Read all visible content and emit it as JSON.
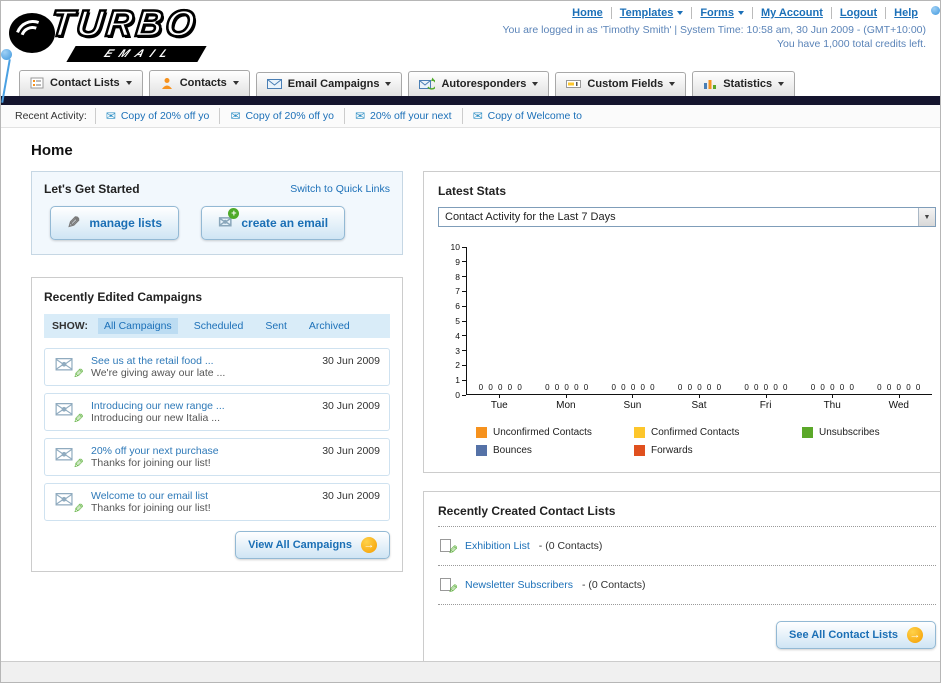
{
  "icons": {
    "envelope": "✉",
    "pencil": "✎",
    "plus": "+",
    "arrow_right": "→",
    "select_arrow": "▼"
  },
  "header": {
    "logo": {
      "title": "TURBO",
      "subtitle": "EMAIL"
    },
    "links": [
      "Home",
      "Templates",
      "Forms",
      "My Account",
      "Logout",
      "Help"
    ],
    "login_info": "You are logged in as 'Timothy Smith' | System Time: 10:58 am, 30 Jun 2009 - (GMT+10:00)",
    "credits_info": "You have 1,000 total credits left."
  },
  "nav_tabs": [
    {
      "label": "Contact Lists"
    },
    {
      "label": "Contacts"
    },
    {
      "label": "Email Campaigns"
    },
    {
      "label": "Autoresponders"
    },
    {
      "label": "Custom Fields"
    },
    {
      "label": "Statistics"
    }
  ],
  "recent_activity": {
    "label": "Recent Activity:",
    "items": [
      "Copy of 20% off yo",
      "Copy of 20% off yo",
      "20% off your next",
      "Copy of Welcome to"
    ]
  },
  "page_title": "Home",
  "get_started": {
    "title": "Let's Get Started",
    "switch_link": "Switch to Quick Links",
    "manage_lists_label": "manage lists",
    "create_email_label": "create an email"
  },
  "campaigns": {
    "title": "Recently Edited Campaigns",
    "show_label": "SHOW:",
    "tabs": [
      {
        "label": "All Campaigns",
        "selected": true
      },
      {
        "label": "Scheduled",
        "selected": false
      },
      {
        "label": "Sent",
        "selected": false
      },
      {
        "label": "Archived",
        "selected": false
      }
    ],
    "items": [
      {
        "title": "See us at the retail food ...",
        "subtitle": "We're giving away our late ...",
        "date": "30 Jun 2009"
      },
      {
        "title": "Introducing our new range ...",
        "subtitle": "Introducing our new Italia ...",
        "date": "30 Jun 2009"
      },
      {
        "title": "20% off your next purchase",
        "subtitle": "Thanks for joining our list!",
        "date": "30 Jun 2009"
      },
      {
        "title": "Welcome to our email list",
        "subtitle": "Thanks for joining our list!",
        "date": "30 Jun 2009"
      }
    ],
    "view_all_label": "View All Campaigns"
  },
  "stats": {
    "title": "Latest Stats",
    "dropdown_value": "Contact Activity for the Last 7 Days",
    "chart_data": {
      "type": "bar",
      "title": "Contact Activity for the Last 7 Days",
      "categories": [
        "Tue",
        "Mon",
        "Sun",
        "Sat",
        "Fri",
        "Thu",
        "Wed"
      ],
      "series": [
        {
          "name": "Unconfirmed Contacts",
          "color": "#f6921e",
          "values": [
            0,
            0,
            0,
            0,
            0,
            0,
            0
          ]
        },
        {
          "name": "Confirmed Contacts",
          "color": "#fdc62b",
          "values": [
            0,
            0,
            0,
            0,
            0,
            0,
            0
          ]
        },
        {
          "name": "Unsubscribes",
          "color": "#5ba829",
          "values": [
            0,
            0,
            0,
            0,
            0,
            0,
            0
          ]
        },
        {
          "name": "Bounces",
          "color": "#5572a7",
          "values": [
            0,
            0,
            0,
            0,
            0,
            0,
            0
          ]
        },
        {
          "name": "Forwards",
          "color": "#e0501e",
          "values": [
            0,
            0,
            0,
            0,
            0,
            0,
            0
          ]
        }
      ],
      "xlabel": "",
      "ylabel": "",
      "ylim": [
        0,
        10
      ],
      "ytick_step": 1,
      "grid": false,
      "legend_position": "bottom"
    }
  },
  "contact_lists": {
    "title": "Recently Created Contact Lists",
    "items": [
      {
        "name": "Exhibition List",
        "detail": "- (0 Contacts)"
      },
      {
        "name": "Newsletter Subscribers",
        "detail": "- (0 Contacts)"
      }
    ],
    "see_all_label": "See All Contact Lists"
  }
}
